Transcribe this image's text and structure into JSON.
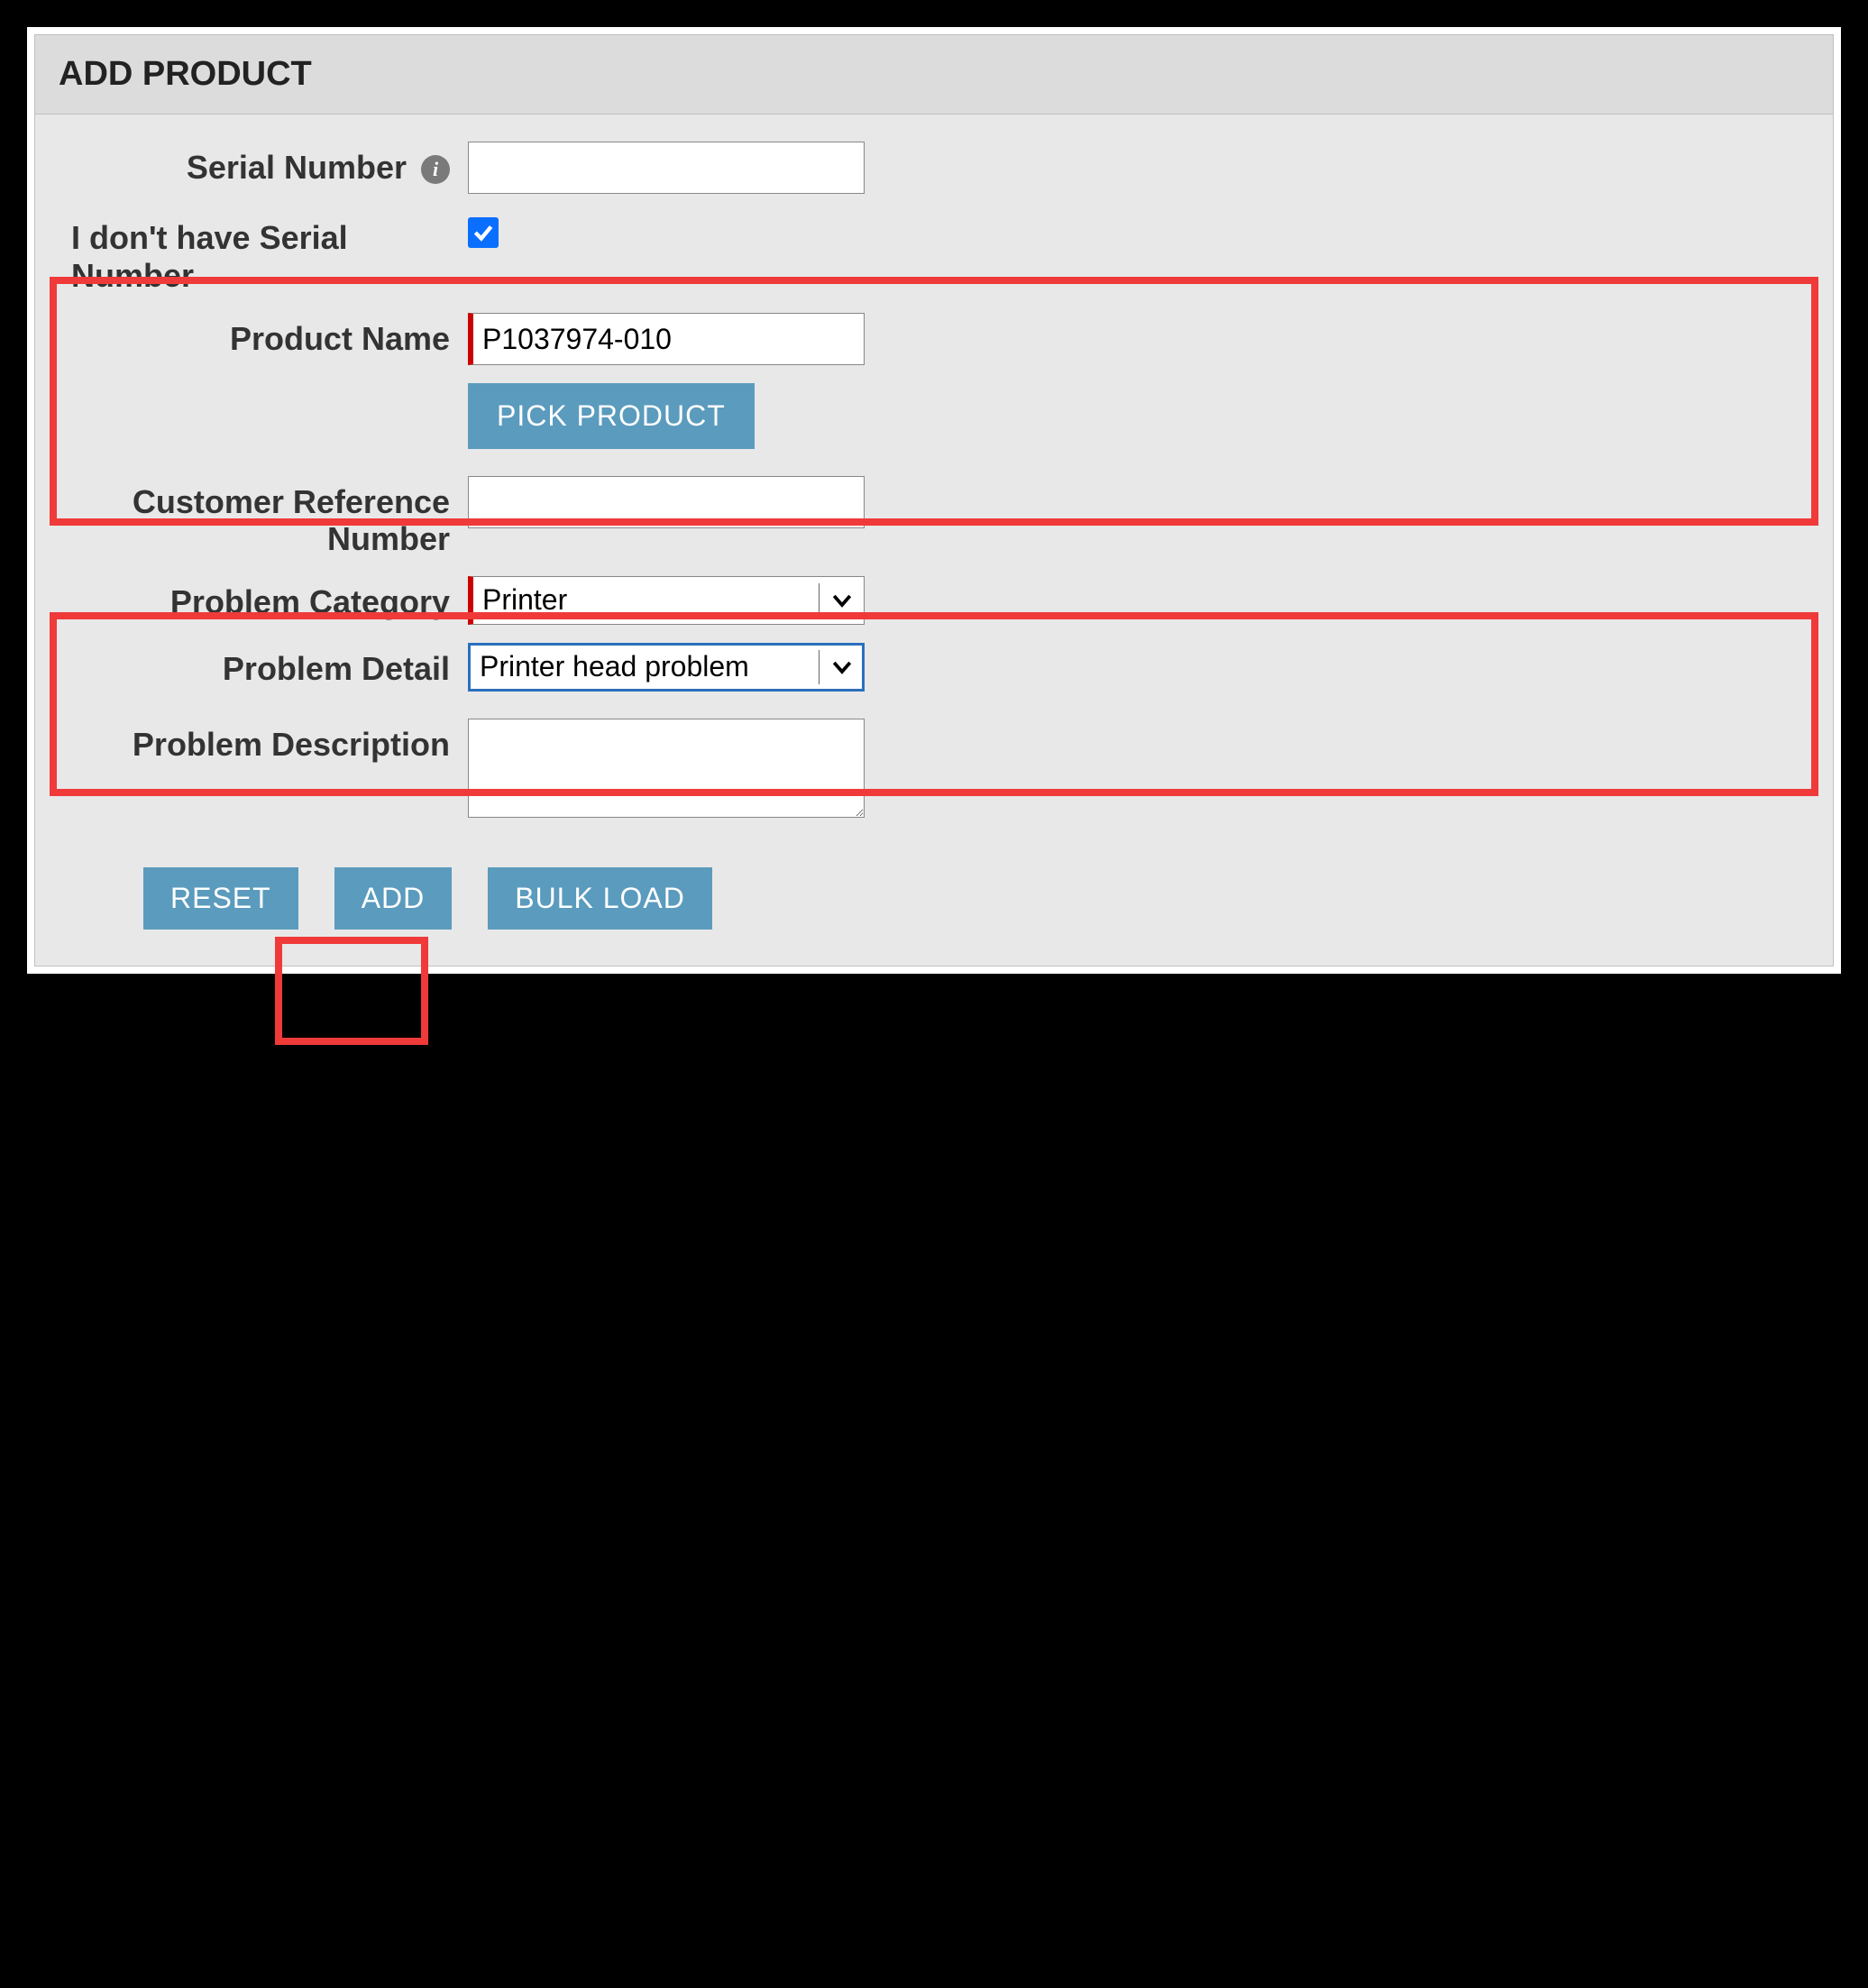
{
  "header": {
    "title": "ADD PRODUCT"
  },
  "form": {
    "serial_number": {
      "label": "Serial Number",
      "value": ""
    },
    "no_serial": {
      "label": "I don't have Serial Number",
      "checked": true
    },
    "product_name": {
      "label": "Product Name",
      "value": "P1037974-010"
    },
    "pick_product_label": "PICK PRODUCT",
    "customer_ref": {
      "label": "Customer Reference Number",
      "value": ""
    },
    "problem_category": {
      "label": "Problem Category",
      "value": "Printer"
    },
    "problem_detail": {
      "label": "Problem Detail",
      "value": "Printer head problem"
    },
    "problem_description": {
      "label": "Problem Description",
      "value": ""
    }
  },
  "buttons": {
    "reset": "RESET",
    "add": "ADD",
    "bulk_load": "BULK LOAD"
  }
}
